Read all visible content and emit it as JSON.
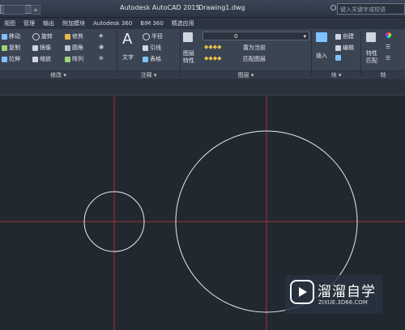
{
  "window": {
    "app_title": "Autodesk AutoCAD 2015",
    "doc_title": "Drawing1.dwg",
    "search_placeholder": "键入关键字或短语"
  },
  "menu_tabs": [
    "视图",
    "管理",
    "输出",
    "附加模块",
    "Autodesk 360",
    "BIM 360",
    "精选应用"
  ],
  "ribbon": {
    "modify": {
      "title": "修改 ▾",
      "items": [
        "移动",
        "旋转",
        "修剪",
        "复制",
        "镜像",
        "圆角",
        "拉伸",
        "缩放",
        "阵列"
      ]
    },
    "annotation": {
      "title": "注释 ▾",
      "text_label": "文字",
      "items": [
        "半径",
        "引线",
        "表格"
      ]
    },
    "layers": {
      "title": "图层 ▾",
      "layer_props": "图层\n特性",
      "current_layer": "0",
      "set_current": "置为当前",
      "match_layer": "匹配图层"
    },
    "block": {
      "title": "块 ▾",
      "insert": "插入",
      "create": "创建",
      "edit": "编辑"
    },
    "properties": {
      "match": "特性\n匹配"
    }
  },
  "watermark": {
    "main": "溜溜自学",
    "sub": "ZIXUE.3D66.COM"
  },
  "colors": {
    "canvas_bg": "#212830",
    "crosshair": "#c8323a",
    "circle": "#e8ecef"
  }
}
